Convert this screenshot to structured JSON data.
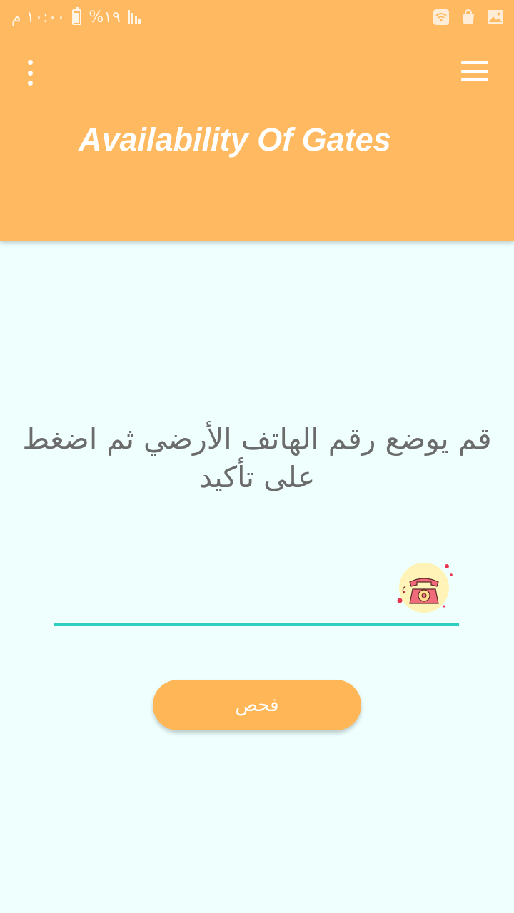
{
  "status_bar": {
    "time": "١٠:٠٠ م",
    "battery": "%١٩",
    "icons": [
      "wifi-icon",
      "shopping-bag-icon",
      "image-icon"
    ]
  },
  "app_bar": {
    "title": "Availability Of Gates",
    "menu_icon": "more-vert-icon",
    "nav_icon": "hamburger-menu-icon"
  },
  "main": {
    "instruction": "قم يوضع رقم الهاتف الأرضي ثم اضغط على تأكيد",
    "phone_input": {
      "value": "",
      "placeholder": "",
      "icon": "telephone-icon"
    },
    "check_button_label": "فحص"
  },
  "colors": {
    "header": "#FFB961",
    "background": "#EEFFFE",
    "underline": "#2ECFC0",
    "button": "#FFB656"
  }
}
